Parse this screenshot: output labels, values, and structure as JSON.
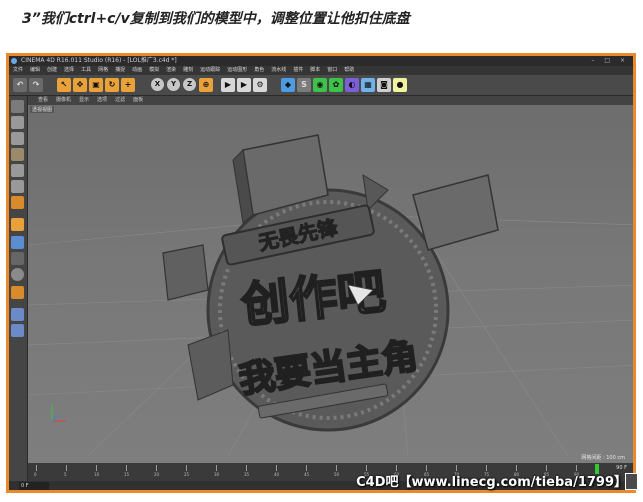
{
  "caption": "3”我们ctrl+c/v复制到我们的模型中，调整位置让他扣住底盘",
  "window": {
    "title": "CINEMA 4D R16.011 Studio (R16) - [LOL推广3.c4d *]"
  },
  "menubar": {
    "items": [
      "文件",
      "编辑",
      "创建",
      "选择",
      "工具",
      "网格",
      "捕捉",
      "动画",
      "模拟",
      "渲染",
      "雕刻",
      "运动跟踪",
      "运动图形",
      "角色",
      "流水线",
      "插件",
      "脚本",
      "窗口",
      "帮助"
    ]
  },
  "viewport": {
    "menu": [
      "查看",
      "摄像机",
      "显示",
      "选项",
      "过滤",
      "面板"
    ],
    "label": "透视视图",
    "grid_label": "网格间距 : 100 cm"
  },
  "timeline": {
    "ticks": [
      "0",
      "5",
      "10",
      "15",
      "20",
      "25",
      "30",
      "35",
      "40",
      "45",
      "50",
      "55",
      "60",
      "65",
      "70",
      "75",
      "80",
      "85",
      "90"
    ],
    "end_frame": "90 F",
    "current_frame": "0 F"
  },
  "model_text": {
    "line1": "无畏先锋",
    "line2": "创作吧",
    "line3": "我要当主角"
  },
  "watermark": "C4D吧【www.linecg.com/tieba/1799】",
  "colors": {
    "frame": "#e98a2c",
    "accent_tool": "#e9a23a",
    "playhead": "#34c934"
  }
}
